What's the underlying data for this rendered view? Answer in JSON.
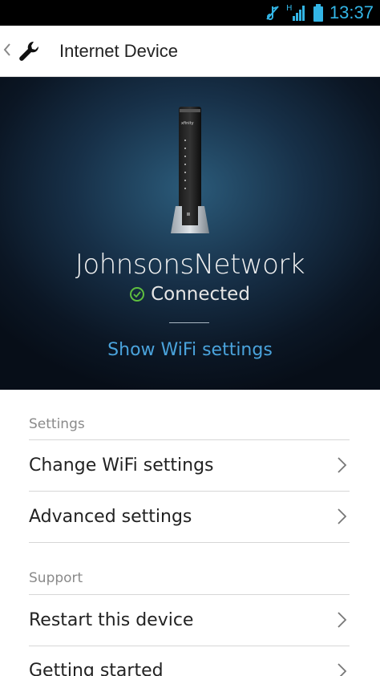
{
  "status_bar": {
    "time": "13:37",
    "network_type": "H"
  },
  "header": {
    "title": "Internet Device"
  },
  "device": {
    "network_name": "JohnsonsNetwork",
    "status": "Connected",
    "show_wifi_label": "Show WiFi settings",
    "brand": "xfinity"
  },
  "sections": [
    {
      "header": "Settings",
      "items": [
        {
          "label": "Change WiFi settings"
        },
        {
          "label": "Advanced settings"
        }
      ]
    },
    {
      "header": "Support",
      "items": [
        {
          "label": "Restart this device"
        },
        {
          "label": "Getting started"
        }
      ]
    }
  ],
  "colors": {
    "accent": "#4aa3dc",
    "status_ok": "#5fbf3f",
    "statusbar_icons": "#33b5e5"
  }
}
